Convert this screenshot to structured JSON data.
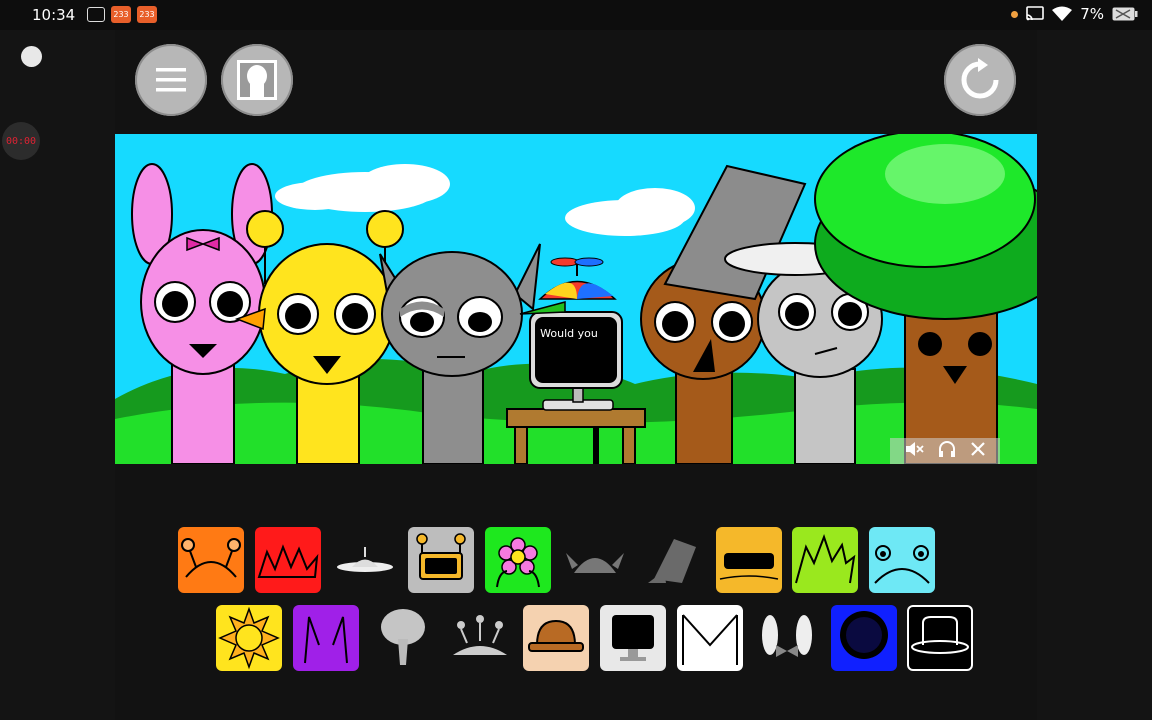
{
  "status_bar": {
    "time": "10:34",
    "notification_badges": [
      "233",
      "233"
    ],
    "battery": "7%"
  },
  "sidebar": {
    "timer": "00:00"
  },
  "toolbar": {
    "menu_icon": "hamburger-menu-icon",
    "character_icon": "character-silhouette-icon",
    "reset_icon": "reset-circular-arrow-icon"
  },
  "stage": {
    "speech_text": "Would you",
    "overlay_controls": [
      "mute-icon",
      "headphones-icon",
      "close-icon"
    ]
  },
  "palette": {
    "row1": [
      "orange-cat-ears",
      "red-spiky-crown",
      "white-antenna-plate",
      "grey-robot-screen",
      "green-flower",
      "grey-horn-helmet",
      "grey-broken-bucket",
      "yellow-visor",
      "lime-spiky-hair",
      "cyan-frog-ears"
    ],
    "row2": [
      "yellow-sun",
      "purple-horns",
      "grey-tree",
      "white-antennae",
      "brown-hat",
      "black-monitor",
      "white-envelope",
      "white-bow-ears",
      "blue-shadow-ball",
      "black-top-hat"
    ]
  },
  "colors": {
    "background": "#141414",
    "sky": "#16daff",
    "grass": "#22d42a",
    "selected_border": "#ffffff"
  }
}
